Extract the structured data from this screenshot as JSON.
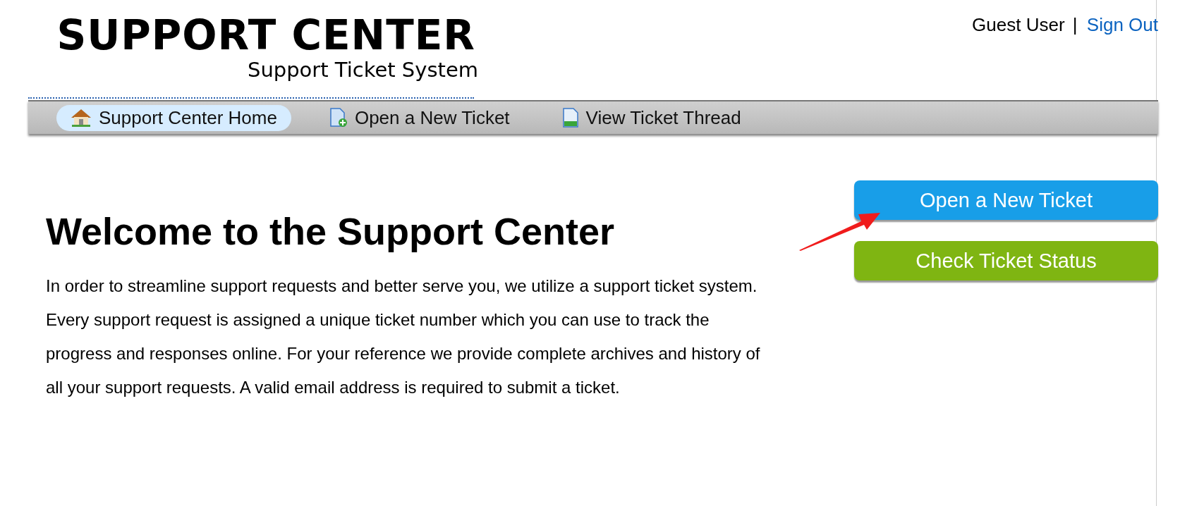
{
  "header": {
    "logo_title": "SUPPORT CENTER",
    "logo_subtitle": "Support Ticket System",
    "user": "Guest User",
    "separator": "|",
    "sign_out": "Sign Out"
  },
  "nav": [
    {
      "label": "Support Center Home",
      "kind": "home",
      "selected": true
    },
    {
      "label": "Open a New Ticket",
      "kind": "new",
      "selected": false
    },
    {
      "label": "View Ticket Thread",
      "kind": "thread",
      "selected": false
    }
  ],
  "main": {
    "heading": "Welcome to the Support Center",
    "body": "In order to streamline support requests and better serve you, we utilize a support ticket system. Every support request is assigned a unique ticket number which you can use to track the progress and responses online. For your reference we provide complete archives and history of all your support requests. A valid email address is required to submit a ticket."
  },
  "actions": [
    {
      "label": "Open a New Ticket",
      "kind": "blue"
    },
    {
      "label": "Check Ticket Status",
      "kind": "green"
    }
  ]
}
